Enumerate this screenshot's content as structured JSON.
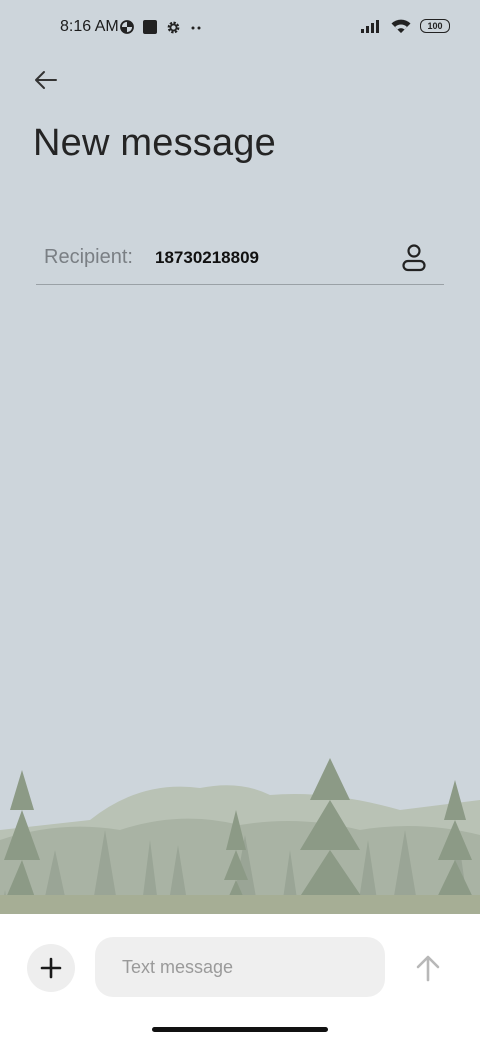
{
  "status_bar": {
    "time": "8:16 AM",
    "battery": "100",
    "icons_left": [
      "data-saver-icon",
      "square-notification-icon",
      "settings-gear-icon",
      "more-dots-icon"
    ],
    "icons_right": [
      "signal-icon",
      "wifi-icon",
      "battery-icon"
    ]
  },
  "header": {
    "back_icon": "arrow-left-icon",
    "title": "New message"
  },
  "recipient": {
    "label": "Recipient:",
    "value": "18730218809",
    "contact_icon": "person-icon"
  },
  "compose": {
    "attach_icon": "plus-icon",
    "placeholder": "Text message",
    "send_icon": "arrow-up-icon"
  },
  "colors": {
    "background": "#cdd5db",
    "compose_bg": "#ffffff",
    "input_bg": "#efefef",
    "send_disabled": "#b8b8b8"
  }
}
